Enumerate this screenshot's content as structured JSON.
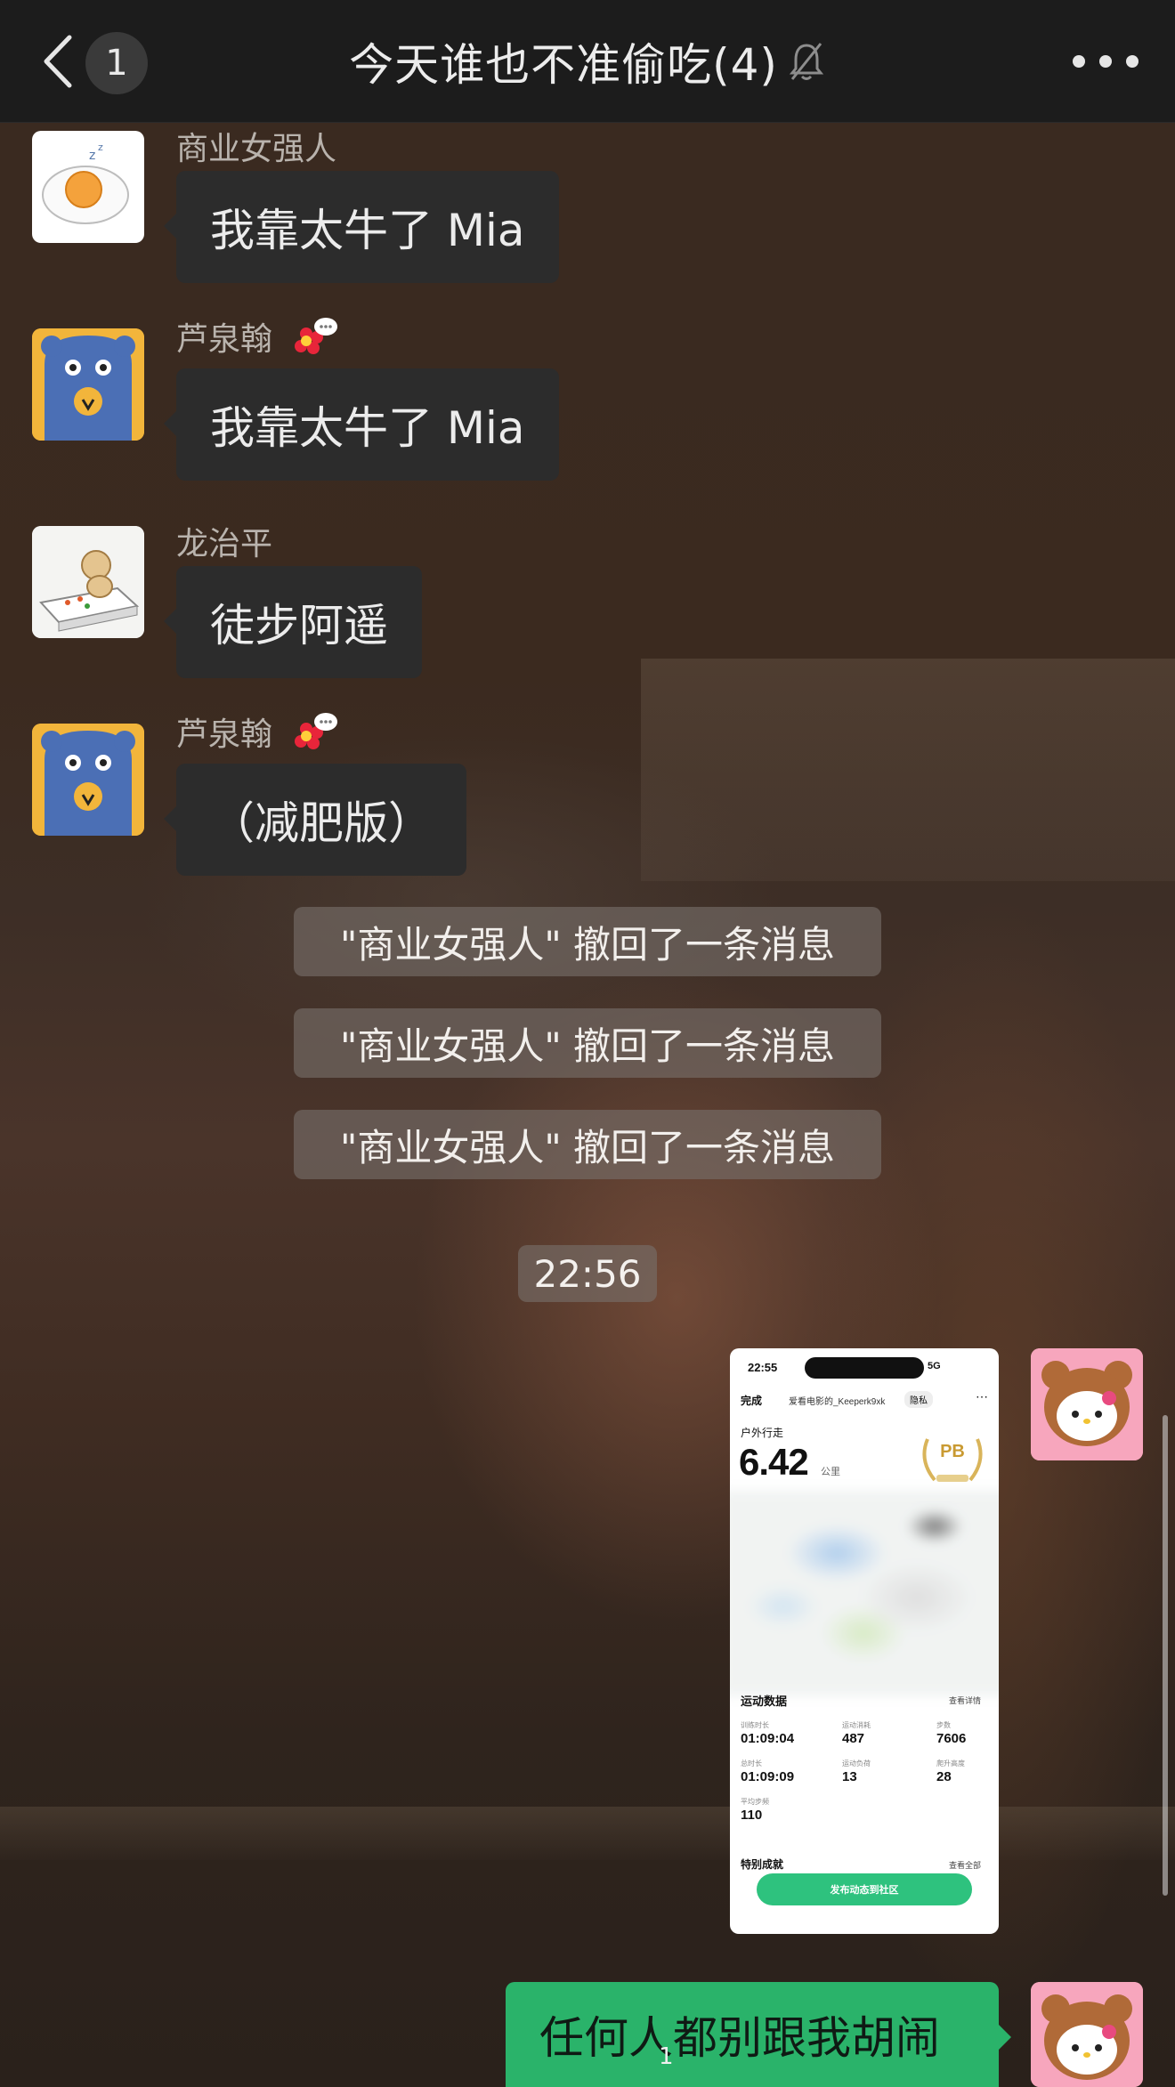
{
  "header": {
    "back_label": "返回",
    "unread_count": "1",
    "title": "今天谁也不准偷吃(4)",
    "more_icon": "more-horizontal-icon",
    "mute_icon": "bell-off-icon"
  },
  "messages": [
    {
      "sender": "商业女强人",
      "text": "我靠太牛了 Mia",
      "avatar": "sleeping-egg-avatar",
      "has_flower": false
    },
    {
      "sender": "芦泉翰",
      "text": "我靠太牛了 Mia",
      "avatar": "blue-bear-avatar",
      "has_flower": true
    },
    {
      "sender": "龙治平",
      "text": "徒步阿遥",
      "avatar": "dog-garden-avatar",
      "has_flower": false
    },
    {
      "sender": "芦泉翰",
      "text": "（减肥版）",
      "avatar": "blue-bear-avatar",
      "has_flower": true
    }
  ],
  "system_notices": [
    "\"商业女强人\" 撤回了一条消息",
    "\"商业女强人\" 撤回了一条消息",
    "\"商业女强人\" 撤回了一条消息"
  ],
  "timestamp": "22:56",
  "image_message": {
    "status_time": "22:55",
    "network": "5G",
    "done": "完成",
    "user": "爱看电影的_Keeperk9xk",
    "privacy": "隐私",
    "activity": "户外行走",
    "distance": "6.42",
    "distance_unit": "公里",
    "badge": "PB",
    "section_title": "运动数据",
    "detail_link": "查看详情",
    "stats": [
      {
        "label": "训练时长",
        "value": "01:09:04"
      },
      {
        "label": "运动消耗",
        "value": "487"
      },
      {
        "label": "步数",
        "value": "7606"
      },
      {
        "label": "总时长",
        "value": "01:09:09"
      },
      {
        "label": "运动负荷",
        "value": "13"
      },
      {
        "label": "爬升高度",
        "value": "28"
      },
      {
        "label": "平均步频",
        "value": "110"
      }
    ],
    "achievements": "特别成就",
    "achievements_all": "查看全部",
    "cta": "发布动态到社区"
  },
  "my_message": {
    "text": "任何人都别跟我胡闹",
    "unread_mini": "1"
  },
  "colors": {
    "bubble_in": "#2c2c2c",
    "bubble_out": "#2ab36a",
    "header_bg": "#1c1c1c"
  }
}
